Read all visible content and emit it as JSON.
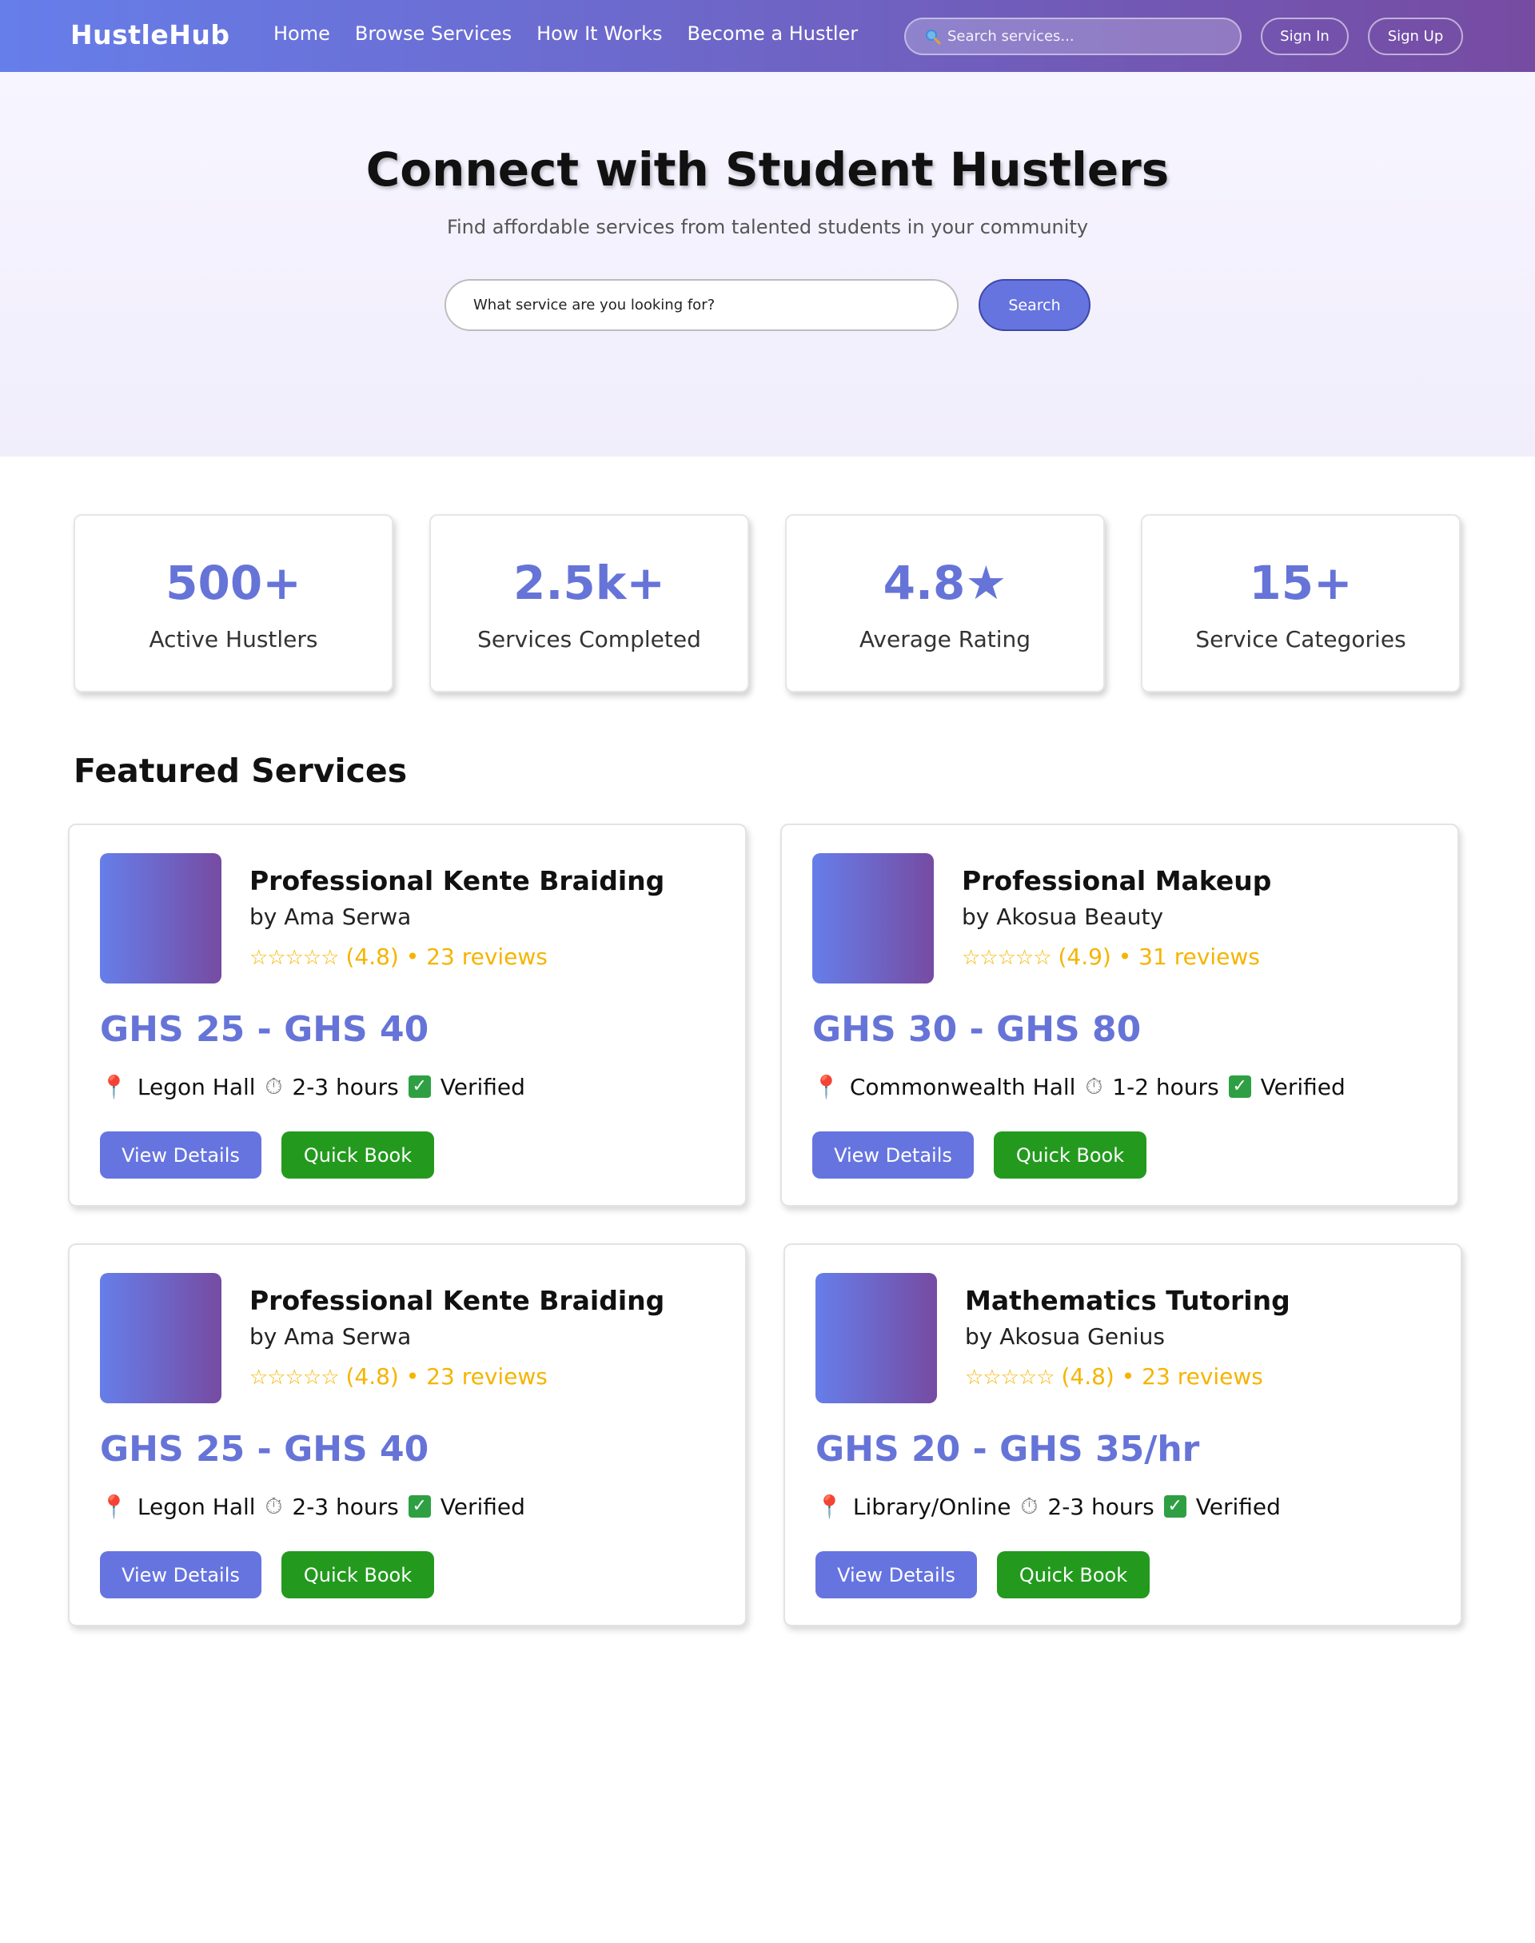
{
  "nav": {
    "logo": "HustleHub",
    "links": [
      "Home",
      "Browse Services",
      "How It Works",
      "Become a Hustler"
    ],
    "search_placeholder": "Search services...",
    "sign_in": "Sign In",
    "sign_up": "Sign Up"
  },
  "hero": {
    "title": "Connect with Student Hustlers",
    "subtitle": "Find affordable services from talented students in your community",
    "search_placeholder": "What service are you looking for?",
    "search_button": "Search"
  },
  "stats": [
    {
      "value": "500+",
      "label": "Active Hustlers"
    },
    {
      "value": "2.5k+",
      "label": "Services Completed"
    },
    {
      "value": "4.8★",
      "label": "Average Rating"
    },
    {
      "value": "15+",
      "label": "Service Categories"
    }
  ],
  "featured": {
    "title": "Featured Services",
    "cards": [
      {
        "title": "Professional Kente Braiding",
        "by": "by Ama Serwa",
        "stars": "☆☆☆☆☆",
        "rating": "(4.8)",
        "reviews": "• 23 reviews",
        "price": "GHS 25 - GHS 40",
        "location": "Legon Hall",
        "duration": "2-3 hours",
        "verified": "Verified",
        "view": "View Details",
        "book": "Quick Book"
      },
      {
        "title": "Professional Makeup",
        "by": "by Akosua Beauty",
        "stars": "☆☆☆☆☆",
        "rating": "(4.9)",
        "reviews": "• 31 reviews",
        "price": "GHS 30 - GHS 80",
        "location": "Commonwealth Hall",
        "duration": "1-2 hours",
        "verified": "Verified",
        "view": "View Details",
        "book": "Quick Book"
      },
      {
        "title": "Professional Kente Braiding",
        "by": "by Ama Serwa",
        "stars": "☆☆☆☆☆",
        "rating": "(4.8)",
        "reviews": "• 23 reviews",
        "price": "GHS 25 - GHS 40",
        "location": "Legon Hall",
        "duration": "2-3 hours",
        "verified": "Verified",
        "view": "View Details",
        "book": "Quick Book"
      },
      {
        "title": "Mathematics Tutoring",
        "by": "by Akosua Genius",
        "stars": "☆☆☆☆☆",
        "rating": "(4.8)",
        "reviews": "• 23 reviews",
        "price": "GHS 20 - GHS 35/hr",
        "location": "Library/Online",
        "duration": "2-3 hours",
        "verified": "Verified",
        "view": "View Details",
        "book": "Quick Book"
      }
    ]
  },
  "colors": {
    "brand_start": "#667eea",
    "brand_end": "#764ba2",
    "accent": "#6674d8",
    "book_green": "#239a1e",
    "rating_gold": "#f5b400"
  }
}
